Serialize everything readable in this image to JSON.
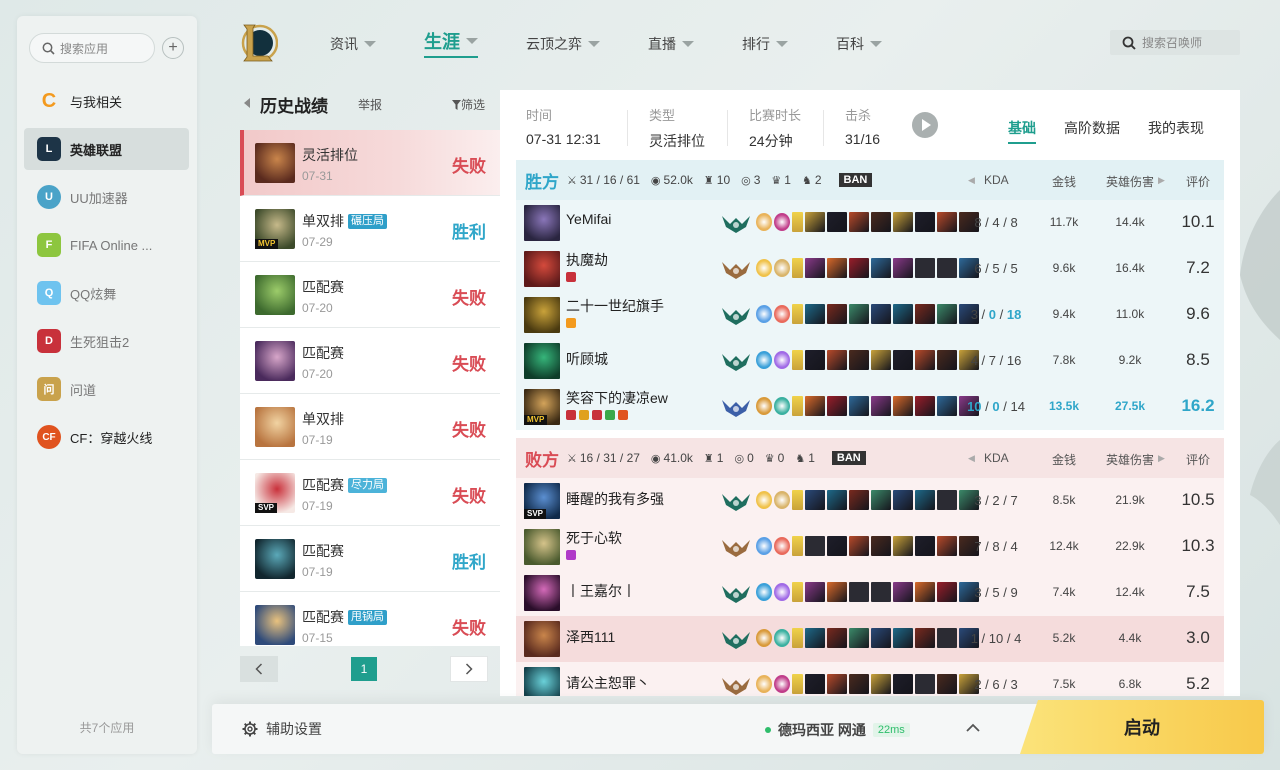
{
  "sidebar": {
    "search_placeholder": "搜索应用",
    "add": "+",
    "apps": [
      {
        "label": "与我相关",
        "icon": "related-icon",
        "color": "#f39a1e"
      },
      {
        "label": "英雄联盟",
        "icon": "lol-icon",
        "color": "#1d3447"
      },
      {
        "label": "UU加速器",
        "icon": "uu-icon",
        "color": "#4aa3c8"
      },
      {
        "label": "FIFA Online ...",
        "icon": "fifa-icon",
        "color": "#8dc63f"
      },
      {
        "label": "QQ炫舞",
        "icon": "qqx5-icon",
        "color": "#6ec3ef"
      },
      {
        "label": "生死狙击2",
        "icon": "ssjj-icon",
        "color": "#c8313b"
      },
      {
        "label": "问道",
        "icon": "wendao-icon",
        "color": "#c9a24c"
      },
      {
        "label": "CF：穿越火线",
        "icon": "cf-icon",
        "color": "#e0531f"
      }
    ],
    "footer": "共7个应用"
  },
  "nav": {
    "items": [
      {
        "label": "资讯"
      },
      {
        "label": "生涯"
      },
      {
        "label": "云顶之弈"
      },
      {
        "label": "直播"
      },
      {
        "label": "排行"
      },
      {
        "label": "百科"
      }
    ],
    "search_placeholder": "搜索召唤师"
  },
  "history": {
    "title": "历史战绩",
    "report": "举报",
    "filter": "筛选",
    "matches": [
      {
        "type": "灵活排位",
        "date": "07-31",
        "result": "失败",
        "tag": "",
        "medal": "",
        "active": true,
        "thumb": [
          "#5a2a1e",
          "#c9854b"
        ]
      },
      {
        "type": "单双排",
        "date": "07-29",
        "result": "胜利",
        "tag": "碾压局",
        "medal": "MVP",
        "active": false,
        "thumb": [
          "#3c4a2a",
          "#c6b98a"
        ]
      },
      {
        "type": "匹配赛",
        "date": "07-20",
        "result": "失败",
        "tag": "",
        "medal": "",
        "active": false,
        "thumb": [
          "#3d6a2e",
          "#9ccc6a"
        ]
      },
      {
        "type": "匹配赛",
        "date": "07-20",
        "result": "失败",
        "tag": "",
        "medal": "",
        "active": false,
        "thumb": [
          "#4a2a5c",
          "#d7a6c9"
        ]
      },
      {
        "type": "单双排",
        "date": "07-19",
        "result": "失败",
        "tag": "",
        "medal": "",
        "active": false,
        "thumb": [
          "#b8743f",
          "#f1d3a2"
        ]
      },
      {
        "type": "匹配赛",
        "date": "07-19",
        "result": "失败",
        "tag": "尽力局",
        "medal": "SVP",
        "active": false,
        "thumb": [
          "#f6e9e5",
          "#c9313b"
        ]
      },
      {
        "type": "匹配赛",
        "date": "07-19",
        "result": "胜利",
        "tag": "",
        "medal": "",
        "active": false,
        "thumb": [
          "#11262e",
          "#5ba9b9"
        ]
      },
      {
        "type": "匹配赛",
        "date": "07-15",
        "result": "失败",
        "tag": "甩锅局",
        "medal": "",
        "active": false,
        "thumb": [
          "#2e4a7a",
          "#e9c27e"
        ]
      }
    ],
    "page": "1"
  },
  "detail": {
    "info": [
      {
        "label": "时间",
        "value": "07-31 12:31"
      },
      {
        "label": "类型",
        "value": "灵活排位"
      },
      {
        "label": "比赛时长",
        "value": "24分钟"
      },
      {
        "label": "击杀",
        "value": "31/16"
      }
    ],
    "tabs": [
      "基础",
      "高阶数据",
      "我的表现"
    ],
    "columns": {
      "kda": "KDA",
      "gold": "金钱",
      "damage": "英雄伤害",
      "score": "评价"
    },
    "ban_label": "BAN",
    "teams": [
      {
        "name": "胜方",
        "kda": "31 / 16 / 61",
        "gold": "52.0k",
        "towers": "10",
        "inhibitors": "3",
        "barons": "1",
        "dragons": "2",
        "players": [
          {
            "name": "YeMifai",
            "kda": "8 / 4 / 8",
            "gold": "11.7k",
            "damage": "14.4k",
            "score": "10.1",
            "avatar": [
              "#2a2540",
              "#8a76b9"
            ],
            "rank": "#1f6e5f",
            "badges": []
          },
          {
            "name": "执魔劫",
            "kda": "6 / 5 / 5",
            "gold": "9.6k",
            "damage": "16.4k",
            "score": "7.2",
            "avatar": [
              "#5e1a1a",
              "#d44a3c"
            ],
            "rank": "#9a6b3f",
            "badges": [
              "#c8313b"
            ]
          },
          {
            "name": "二十一世纪旗手",
            "kda": "3 / 0 / 18",
            "gold": "9.4k",
            "damage": "11.0k",
            "score": "9.6",
            "avatar": [
              "#4a3a10",
              "#c9a23a"
            ],
            "rank": "#1f6e5f",
            "badges": [
              "#f39a1e"
            ],
            "kda_hl": true
          },
          {
            "name": "听顾城",
            "kda": "4 / 7 / 16",
            "gold": "7.8k",
            "damage": "9.2k",
            "score": "8.5",
            "avatar": [
              "#0e3d2a",
              "#36b57a"
            ],
            "rank": "#1f6e5f",
            "badges": []
          },
          {
            "name": "笑容下的凄凉ew",
            "kda": "10 / 0 / 14",
            "gold": "13.5k",
            "damage": "27.5k",
            "score": "16.2",
            "avatar": [
              "#3b2a14",
              "#d3a35a"
            ],
            "rank": "#3c5fa8",
            "badges": [
              "#c8313b",
              "#e0a11e",
              "#c8313b",
              "#3aa84a",
              "#e0531f"
            ],
            "medal": "MVP",
            "highlight_blue": true
          }
        ]
      },
      {
        "name": "败方",
        "kda": "16 / 31 / 27",
        "gold": "41.0k",
        "towers": "1",
        "inhibitors": "0",
        "barons": "0",
        "dragons": "1",
        "players": [
          {
            "name": "睡醒的我有多强",
            "kda": "3 / 2 / 7",
            "gold": "8.5k",
            "damage": "21.9k",
            "score": "10.5",
            "avatar": [
              "#102a4a",
              "#5b8fd1"
            ],
            "rank": "#1f6e5f",
            "badges": [],
            "medal": "SVP"
          },
          {
            "name": "死于心软",
            "kda": "7 / 8 / 4",
            "gold": "12.4k",
            "damage": "22.9k",
            "score": "10.3",
            "avatar": [
              "#4a5a2e",
              "#d5c38a"
            ],
            "rank": "#9a6b3f",
            "badges": [
              "#b03ac8"
            ]
          },
          {
            "name": "丨王嘉尔丨",
            "kda": "3 / 5 / 9",
            "gold": "7.4k",
            "damage": "12.4k",
            "score": "7.5",
            "avatar": [
              "#2a0e2a",
              "#d46ab9"
            ],
            "rank": "#1f6e5f",
            "badges": []
          },
          {
            "name": "泽西111",
            "kda": "1 / 10 / 4",
            "gold": "5.2k",
            "damage": "4.4k",
            "score": "3.0",
            "avatar": [
              "#5a2a1e",
              "#c9854b"
            ],
            "rank": "#1f6e5f",
            "badges": [],
            "self": true
          },
          {
            "name": "请公主恕罪丶",
            "kda": "2 / 6 / 3",
            "gold": "7.5k",
            "damage": "6.8k",
            "score": "5.2",
            "avatar": [
              "#14404a",
              "#6ad1d9"
            ],
            "rank": "#9a6b3f",
            "badges": []
          }
        ]
      }
    ]
  },
  "bottom": {
    "assist": "辅助设置",
    "server": "德玛西亚 网通",
    "ping": "22ms",
    "launch": "启动"
  },
  "colors": {
    "accent": "#1f9e8e",
    "win": "#2fa6c9",
    "lose": "#d94c55",
    "launch": "#f8c94a"
  }
}
